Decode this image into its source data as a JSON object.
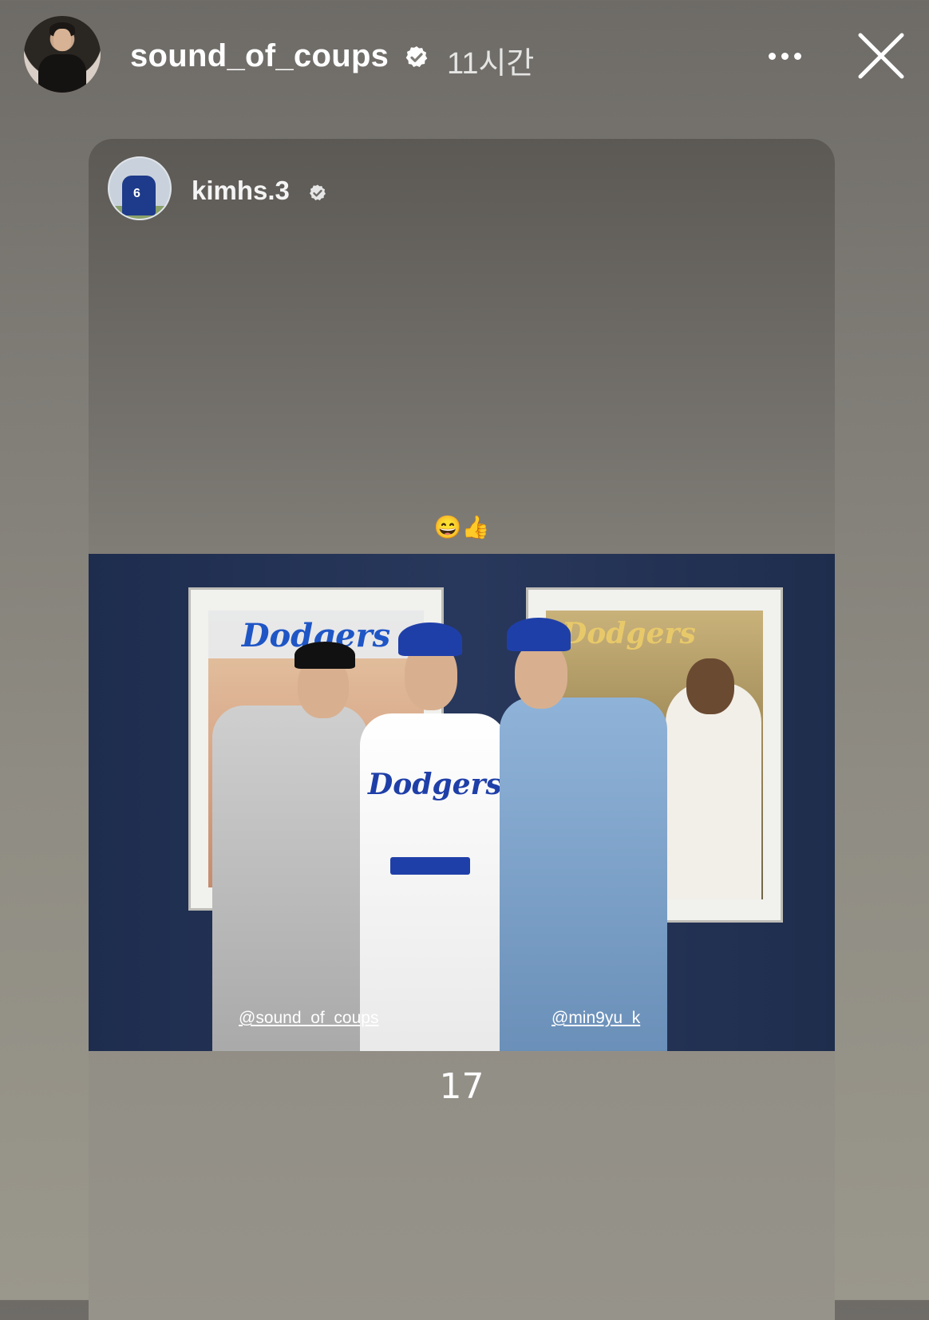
{
  "header": {
    "username": "sound_of_coups",
    "time": "11시간",
    "icons": {
      "avatar": "profile-avatar",
      "verified": "verified-badge-icon",
      "more": "more-options-icon",
      "close": "close-icon"
    }
  },
  "shared_post": {
    "username": "kimhs.3",
    "emoji": "😄👍",
    "photo": {
      "tag_left": "@sound_of_coups",
      "tag_right": "@min9yu_k",
      "poster_left_title": "Dodgers",
      "poster_right_title": "Dodgers",
      "jersey_text": "Dodgers"
    },
    "text": "17"
  },
  "colors": {
    "background": "#807d77",
    "dodger_blue": "#1f3fa8",
    "wall": "#24345a"
  }
}
